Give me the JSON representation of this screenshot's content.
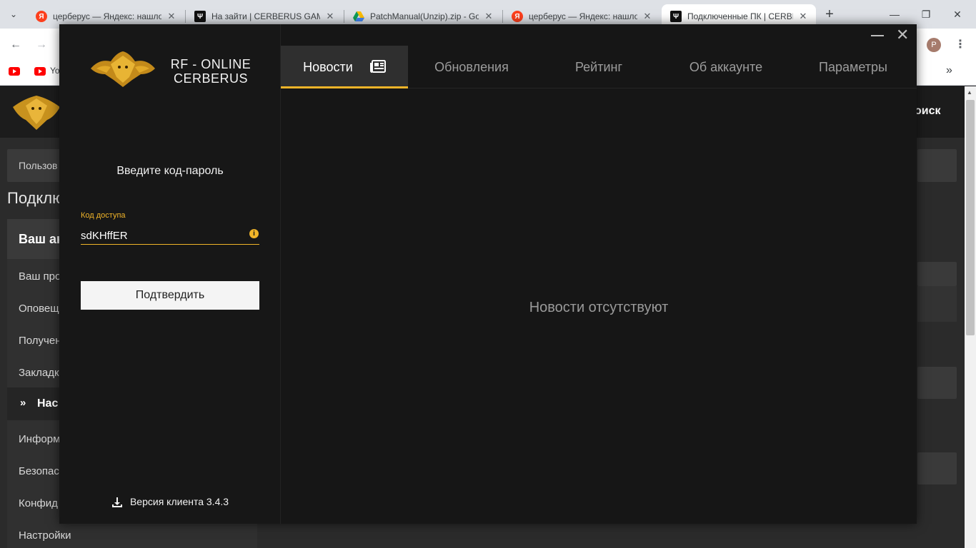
{
  "browser": {
    "tabs": [
      {
        "title": "церберус — Яндекс: нашло",
        "favicon": "yandex-icon"
      },
      {
        "title": "На зайти | CERBERUS GAME",
        "favicon": "cerberus-icon"
      },
      {
        "title": "PatchManual(Unzip).zip - Go",
        "favicon": "google-drive-icon"
      },
      {
        "title": "церберус — Яндекс: нашло",
        "favicon": "yandex-icon"
      },
      {
        "title": "Подключенные ПК | CERBE",
        "favicon": "cerberus-icon",
        "active": true
      }
    ],
    "new_tab": "+",
    "profile_initial": "P",
    "bookmark_label": "Yo",
    "bookmarks_more": "»"
  },
  "background_page": {
    "search_label": "оиск",
    "breadcrumb": "Пользов",
    "heading": "Подклю",
    "sidebar_header": "Ваш ак",
    "sidebar_items": [
      "Ваш про",
      "Оповещ",
      "Получен",
      "Закладк"
    ],
    "sidebar_active": "Нас",
    "sidebar_items_after": [
      "Информ",
      "Безопас",
      "Конфид",
      "Настройки"
    ]
  },
  "launcher": {
    "brand_line1": "RF - ONLINE",
    "brand_line2": "CERBERUS",
    "prompt": "Введите код-пароль",
    "access_label": "Код доступа",
    "access_value": "sdKHffER",
    "confirm_label": "Подтвердить",
    "version": "Версия клиента 3.4.3",
    "tabs": [
      {
        "label": "Новости",
        "active": true
      },
      {
        "label": "Обновления"
      },
      {
        "label": "Рейтинг"
      },
      {
        "label": "Об аккаунте"
      },
      {
        "label": "Параметры"
      }
    ],
    "empty_message": "Новости отсутствуют",
    "accent_color": "#f0b429"
  }
}
